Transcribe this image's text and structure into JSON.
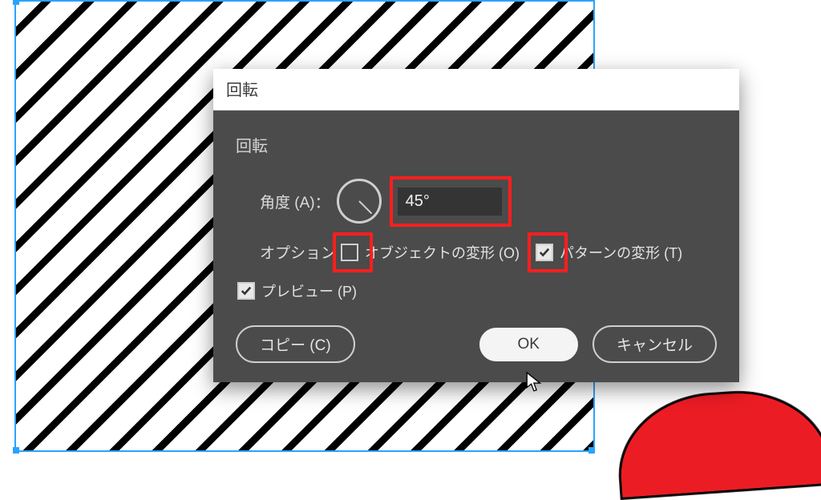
{
  "dialog": {
    "title": "回転",
    "group_label": "回転",
    "angle": {
      "label": "角度 (A)：",
      "value": "45°",
      "deg": 45
    },
    "options": {
      "label": "オプション",
      "transform_objects": {
        "label": "オブジェクトの変形 (O)",
        "checked": false
      },
      "transform_patterns": {
        "label": "パターンの変形 (T)",
        "checked": true
      }
    },
    "preview": {
      "label": "プレビュー (P)",
      "checked": true
    },
    "buttons": {
      "copy": "コピー (C)",
      "ok": "OK",
      "cancel": "キャンセル"
    }
  },
  "annotations": {
    "highlight_color": "#ff1e1e",
    "highlighted": [
      "angle-input",
      "checkbox-transform-objects",
      "checkbox-transform-patterns"
    ]
  },
  "canvas": {
    "selection_color": "#2aa3ff",
    "pattern": "diagonal-stripes-45deg"
  }
}
